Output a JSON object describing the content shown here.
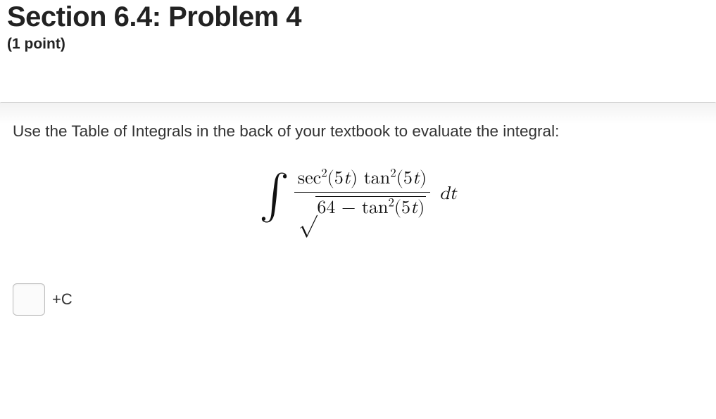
{
  "header": {
    "title": "Section 6.4: Problem 4",
    "points": "(1 point)"
  },
  "problem": {
    "instruction": "Use the Table of Integrals in the back of your textbook to evaluate the integral:",
    "integral": {
      "symbol": "∫",
      "numerator": {
        "sec_label": "sec",
        "sec_exp": "2",
        "sec_arg": "(5t)",
        "tan_label": "tan",
        "tan_exp": "2",
        "tan_arg": "(5t)"
      },
      "denominator": {
        "radical": "√",
        "constant": "64",
        "minus": " − ",
        "tan_label": "tan",
        "tan_exp": "2",
        "tan_arg": "(5t)"
      },
      "differential": "dt"
    }
  },
  "answer": {
    "input_value": "",
    "suffix": "+C"
  }
}
